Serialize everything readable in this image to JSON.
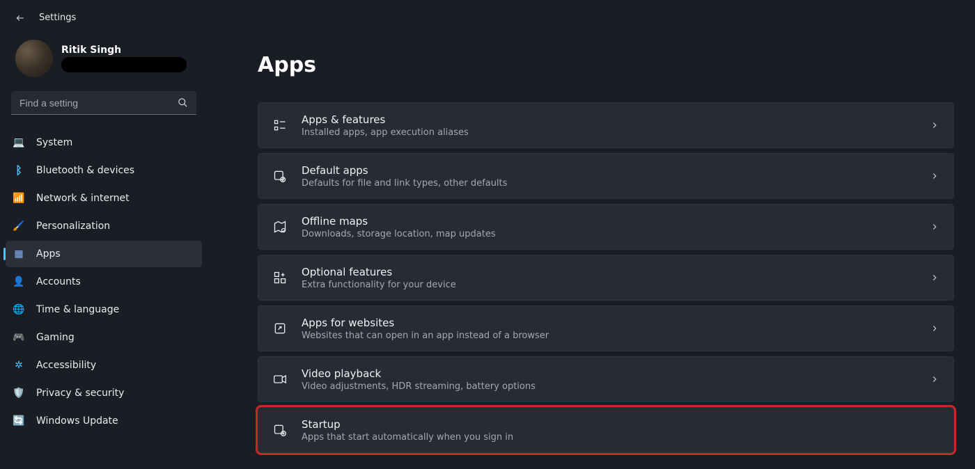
{
  "app": {
    "title": "Settings"
  },
  "profile": {
    "name": "Ritik Singh"
  },
  "search": {
    "placeholder": "Find a setting"
  },
  "sidebar": {
    "items": [
      {
        "label": "System",
        "icon": "💻"
      },
      {
        "label": "Bluetooth & devices",
        "icon": "ᛒ"
      },
      {
        "label": "Network & internet",
        "icon": "📶"
      },
      {
        "label": "Personalization",
        "icon": "🖌️"
      },
      {
        "label": "Apps",
        "icon": "▦",
        "selected": true
      },
      {
        "label": "Accounts",
        "icon": "👤"
      },
      {
        "label": "Time & language",
        "icon": "🌐"
      },
      {
        "label": "Gaming",
        "icon": "🎮"
      },
      {
        "label": "Accessibility",
        "icon": "✲"
      },
      {
        "label": "Privacy & security",
        "icon": "🛡️"
      },
      {
        "label": "Windows Update",
        "icon": "🔄"
      }
    ]
  },
  "main": {
    "title": "Apps",
    "panels": [
      {
        "title": "Apps & features",
        "desc": "Installed apps, app execution aliases"
      },
      {
        "title": "Default apps",
        "desc": "Defaults for file and link types, other defaults"
      },
      {
        "title": "Offline maps",
        "desc": "Downloads, storage location, map updates"
      },
      {
        "title": "Optional features",
        "desc": "Extra functionality for your device"
      },
      {
        "title": "Apps for websites",
        "desc": "Websites that can open in an app instead of a browser"
      },
      {
        "title": "Video playback",
        "desc": "Video adjustments, HDR streaming, battery options"
      },
      {
        "title": "Startup",
        "desc": "Apps that start automatically when you sign in",
        "highlight": true
      }
    ]
  }
}
